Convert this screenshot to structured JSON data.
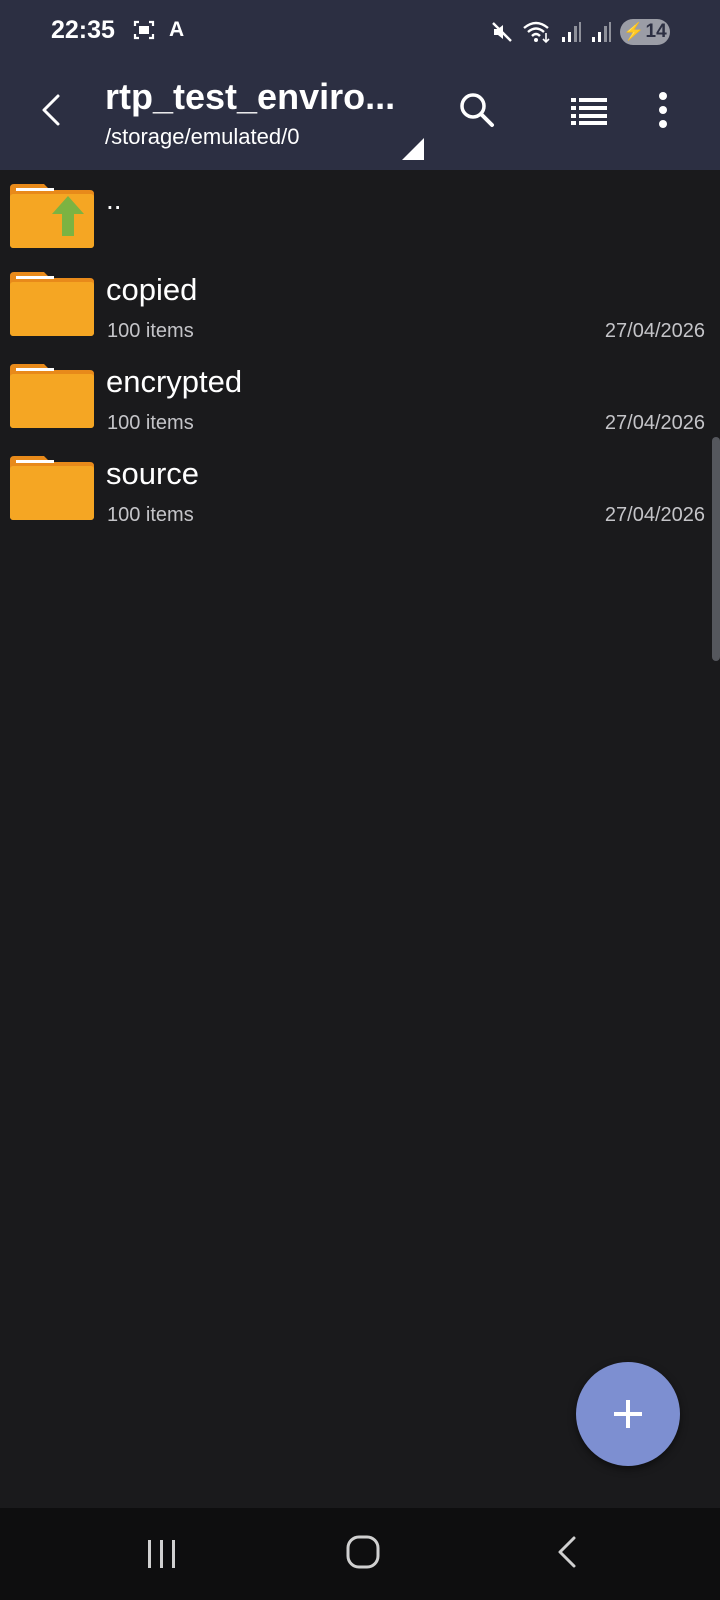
{
  "status_bar": {
    "time": "22:35",
    "letter": "A",
    "battery": "14",
    "icons": [
      "screenshot-icon",
      "mute-icon",
      "wifi-icon",
      "signal-icon",
      "signal-icon",
      "battery-icon"
    ]
  },
  "toolbar": {
    "title": "rtp_test_enviro...",
    "path": "/storage/emulated/0",
    "icons": [
      "back-arrow-icon",
      "search-icon",
      "list-view-icon",
      "more-vertical-icon"
    ]
  },
  "file_list": {
    "parent": {
      "name": ".."
    },
    "items": [
      {
        "name": "copied",
        "meta": "100 items",
        "date": "27/04/2026"
      },
      {
        "name": "encrypted",
        "meta": "100 items",
        "date": "27/04/2026"
      },
      {
        "name": "source",
        "meta": "100 items",
        "date": "27/04/2026"
      }
    ]
  },
  "fab": {
    "icon": "plus-icon"
  },
  "nav_bar": {
    "icons": [
      "recents-icon",
      "home-icon",
      "back-icon"
    ]
  },
  "colors": {
    "app_bar": "#2c2f42",
    "background": "#1a1a1c",
    "folder": "#f5a623",
    "folder_tab": "#e88a1a",
    "fab": "#7d8fd1",
    "up_arrow": "#7cb342"
  }
}
